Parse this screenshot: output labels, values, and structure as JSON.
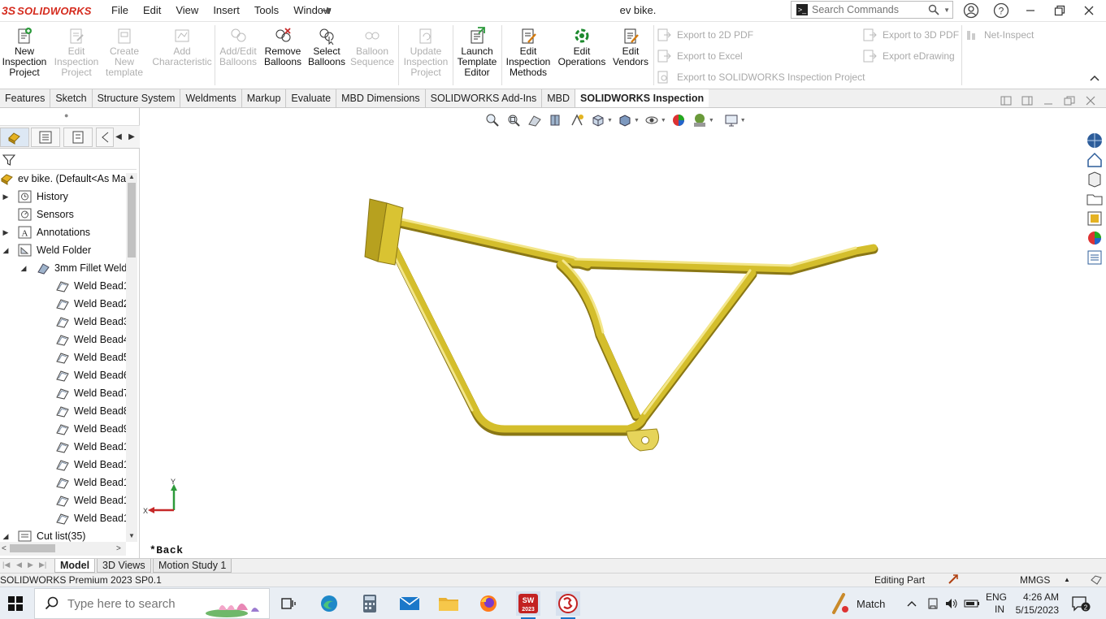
{
  "app": {
    "logo_ds": "3S",
    "logo_name": "SOLIDWORKS",
    "menu": [
      "File",
      "Edit",
      "View",
      "Insert",
      "Tools",
      "Window"
    ],
    "doc_title": "ev bike.",
    "search_placeholder": "Search Commands"
  },
  "ribbon": {
    "buttons": [
      {
        "label1": "New",
        "label2": "Inspection",
        "label3": "Project",
        "enabled": true,
        "icon": "new-inspection-icon"
      },
      {
        "label1": "Edit",
        "label2": "Inspection",
        "label3": "Project",
        "enabled": false,
        "icon": "edit-inspection-icon"
      },
      {
        "label1": "Create",
        "label2": "New",
        "label3": "template",
        "enabled": false,
        "icon": "create-template-icon"
      },
      {
        "label1": "Add",
        "label2": "Characteristic",
        "label3": "",
        "enabled": false,
        "icon": "add-characteristic-icon"
      },
      {
        "label1": "Add/Edit",
        "label2": "Balloons",
        "label3": "",
        "enabled": false,
        "icon": "add-balloons-icon"
      },
      {
        "label1": "Remove",
        "label2": "Balloons",
        "label3": "",
        "enabled": true,
        "icon": "remove-balloons-icon"
      },
      {
        "label1": "Select",
        "label2": "Balloons",
        "label3": "",
        "enabled": true,
        "icon": "select-balloons-icon"
      },
      {
        "label1": "Balloon",
        "label2": "Sequence",
        "label3": "",
        "enabled": false,
        "icon": "balloon-sequence-icon"
      },
      {
        "label1": "Update",
        "label2": "Inspection",
        "label3": "Project",
        "enabled": false,
        "icon": "update-project-icon"
      },
      {
        "label1": "Launch",
        "label2": "Template",
        "label3": "Editor",
        "enabled": true,
        "icon": "launch-template-icon"
      },
      {
        "label1": "Edit",
        "label2": "Inspection",
        "label3": "Methods",
        "enabled": true,
        "icon": "edit-methods-icon"
      },
      {
        "label1": "Edit",
        "label2": "Operations",
        "label3": "",
        "enabled": true,
        "icon": "edit-operations-icon"
      },
      {
        "label1": "Edit",
        "label2": "Vendors",
        "label3": "",
        "enabled": true,
        "icon": "edit-vendors-icon"
      }
    ],
    "export_2d_pdf": "Export to 2D PDF",
    "export_excel": "Export to Excel",
    "export_sw_project": "Export to SOLIDWORKS Inspection Project",
    "export_3d_pdf": "Export to 3D PDF",
    "export_edrawing": "Export eDrawing",
    "net_inspect": "Net-Inspect"
  },
  "tabs": [
    "Features",
    "Sketch",
    "Structure System",
    "Weldments",
    "Markup",
    "Evaluate",
    "MBD Dimensions",
    "SOLIDWORKS Add-Ins",
    "MBD",
    "SOLIDWORKS Inspection"
  ],
  "tree": {
    "root": "ev bike.  (Default<As Mac",
    "history": "History",
    "sensors": "Sensors",
    "annotations": "Annotations",
    "weld_folder": "Weld Folder",
    "fillet_weld": "3mm Fillet Weld",
    "beads": [
      "Weld Bead1",
      "Weld Bead2",
      "Weld Bead3",
      "Weld Bead4",
      "Weld Bead5",
      "Weld Bead6",
      "Weld Bead7",
      "Weld Bead8",
      "Weld Bead9",
      "Weld Bead1(",
      "Weld Bead1",
      "Weld Bead1:",
      "Weld Bead1",
      "Weld Bead1·"
    ],
    "cutlist": "Cut list(35)"
  },
  "viewport": {
    "view_label": "*Back",
    "triad_x": "X",
    "triad_y": "Y",
    "frame_color": "#d9c332"
  },
  "bottom_tabs": [
    "Model",
    "3D Views",
    "Motion Study 1"
  ],
  "status": {
    "product": "SOLIDWORKS Premium 2023 SP0.1",
    "mode": "Editing Part",
    "units": "MMGS"
  },
  "taskbar": {
    "search_placeholder": "Type here to search",
    "weather": "Match",
    "lang1": "ENG",
    "lang2": "IN",
    "time": "4:26 AM",
    "date": "5/15/2023",
    "notif_count": "2",
    "sw_badge": "2023"
  }
}
